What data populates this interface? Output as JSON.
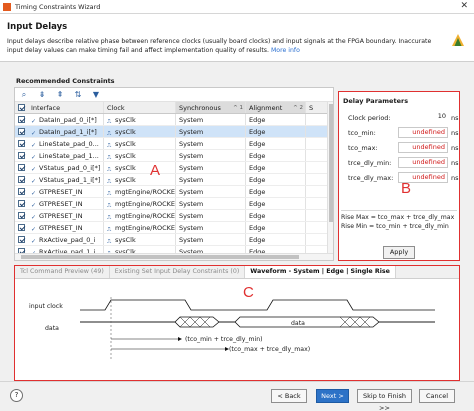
{
  "window": {
    "title": "Timing Constraints Wizard",
    "close_glyph": "✕"
  },
  "header": {
    "title": "Input Delays",
    "description": "Input delays describe relative phase between reference clocks (usually board clocks) and input signals at the FPGA boundary. Inaccurate input delay values can make timing fail and affect implementation quality of results.",
    "more_info": "More info"
  },
  "recommended": {
    "title": "Recommended Constraints",
    "toolbar_icons": [
      "search-icon",
      "collapse-icon",
      "expand-icon",
      "sort-icon",
      "filter-icon"
    ],
    "columns": [
      "Interface",
      "Clock",
      "Synchronous",
      "Alignment",
      "S"
    ],
    "sort_hints": [
      "^ 1",
      "^ 2"
    ],
    "rows": [
      {
        "checked": true,
        "interface": "DataIn_pad_0_i[*]",
        "clock": "sysClk",
        "sync": "System",
        "align": "Edge",
        "selected": false
      },
      {
        "checked": true,
        "interface": "DataIn_pad_1_i[*]",
        "clock": "sysClk",
        "sync": "System",
        "align": "Edge",
        "selected": true
      },
      {
        "checked": true,
        "interface": "LineState_pad_0...",
        "clock": "sysClk",
        "sync": "System",
        "align": "Edge",
        "selected": false
      },
      {
        "checked": true,
        "interface": "LineState_pad_1...",
        "clock": "sysClk",
        "sync": "System",
        "align": "Edge",
        "selected": false
      },
      {
        "checked": true,
        "interface": "VStatus_pad_0_i[*]",
        "clock": "sysClk",
        "sync": "System",
        "align": "Edge",
        "selected": false
      },
      {
        "checked": true,
        "interface": "VStatus_pad_1_i[*]",
        "clock": "sysClk",
        "sync": "System",
        "align": "Edge",
        "selected": false
      },
      {
        "checked": true,
        "interface": "GTPRESET_IN",
        "clock": "mgtEngine/ROCKETIO",
        "sync": "System",
        "align": "Edge",
        "selected": false
      },
      {
        "checked": true,
        "interface": "GTPRESET_IN",
        "clock": "mgtEngine/ROCKETIO",
        "sync": "System",
        "align": "Edge",
        "selected": false
      },
      {
        "checked": true,
        "interface": "GTPRESET_IN",
        "clock": "mgtEngine/ROCKETIO",
        "sync": "System",
        "align": "Edge",
        "selected": false
      },
      {
        "checked": true,
        "interface": "GTPRESET_IN",
        "clock": "mgtEngine/ROCKETIO",
        "sync": "System",
        "align": "Edge",
        "selected": false
      },
      {
        "checked": true,
        "interface": "RxActive_pad_0_i",
        "clock": "sysClk",
        "sync": "System",
        "align": "Edge",
        "selected": false
      },
      {
        "checked": true,
        "interface": "RxActive_pad_1_i",
        "clock": "sysClk",
        "sync": "System",
        "align": "Edge",
        "selected": false
      }
    ]
  },
  "delay_params": {
    "title": "Delay Parameters",
    "rows": [
      {
        "label": "Clock period:",
        "value": "10",
        "unit": "ns",
        "plain": true
      },
      {
        "label": "tco_min:",
        "value": "undefined",
        "unit": "ns",
        "plain": false
      },
      {
        "label": "tco_max:",
        "value": "undefined",
        "unit": "ns",
        "plain": false
      },
      {
        "label": "trce_dly_min:",
        "value": "undefined",
        "unit": "ns",
        "plain": false
      },
      {
        "label": "trce_dly_max:",
        "value": "undefined",
        "unit": "ns",
        "plain": false
      }
    ],
    "rise_max": "Rise Max = tco_max + trce_dly_max",
    "rise_min": "Rise Min = tco_min + trce_dly_min",
    "apply": "Apply"
  },
  "tabs": [
    {
      "label": "Tcl Command Preview (49)",
      "active": false
    },
    {
      "label": "Existing Set Input Delay Constraints (0)",
      "active": false
    },
    {
      "label": "Waveform - System | Edge | Single Rise",
      "active": true
    }
  ],
  "waveform": {
    "clock_label": "input clock",
    "data_label": "data",
    "data_value": "data",
    "min_label": "(tco_min + trce_dly_min)",
    "max_label": "(tco_max + trce_dly_max)"
  },
  "annotations": {
    "a": "A",
    "b": "B",
    "c": "C",
    "color": "#e03030"
  },
  "footer": {
    "help": "?",
    "back": "< Back",
    "next": "Next >",
    "skip": "Skip to Finish >>",
    "cancel": "Cancel"
  }
}
